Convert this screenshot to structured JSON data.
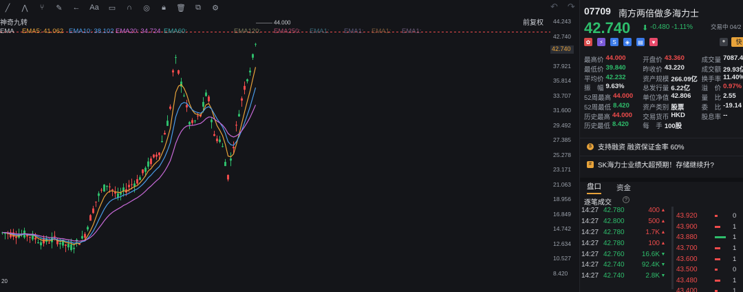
{
  "toolbar": {
    "tools": [
      "draw-line-icon",
      "polyline-icon",
      "fork-icon",
      "text-tool-icon",
      "arrow-icon",
      "font-size-icon",
      "rectangle-icon",
      "magnet-icon",
      "circle-icon",
      "lock-icon",
      "trash-icon",
      "copy-icon",
      "settings-icon"
    ],
    "font_glyph": "Aa"
  },
  "chart": {
    "strategy_label": "神奇九转",
    "restore_label": "前复权",
    "ema": [
      {
        "label": "EMA",
        "value": "",
        "color": "#c9ccd2"
      },
      {
        "label": "EMA5:",
        "value": "41.062",
        "color": "#e8a33a"
      },
      {
        "label": "EMA10:",
        "value": "38.102",
        "color": "#4a9be8"
      },
      {
        "label": "EMA20:",
        "value": "34.724",
        "color": "#c86ad8"
      },
      {
        "label": "EMA60:",
        "value": "",
        "color": "#3aa7a7"
      },
      {
        "label": "EMA120:",
        "value": "",
        "color": "#7a7a5a"
      },
      {
        "label": "EMA250:",
        "value": "",
        "color": "#a04a6a"
      },
      {
        "label": "EMA1:",
        "value": "",
        "color": "#3a6a7a"
      },
      {
        "label": "EMA1:",
        "value": "",
        "color": "#5a5a7a"
      },
      {
        "label": "EMA1:",
        "value": "",
        "color": "#7a5a3a"
      },
      {
        "label": "EMA1:",
        "value": "",
        "color": "#6a5a7a"
      }
    ],
    "price_ticks": [
      "44.243",
      "42.740",
      "40.029",
      "37.921",
      "35.814",
      "33.707",
      "31.600",
      "29.492",
      "27.385",
      "25.278",
      "23.171",
      "21.063",
      "18.956",
      "16.849",
      "14.742",
      "12.634",
      "10.527",
      "8.420"
    ],
    "high_label": "44.000",
    "low_label": "8.420",
    "last_price": "42.740",
    "colors": {
      "up": "#2ebd6b",
      "down": "#ef4b4b",
      "dashed": "#ef4b4b"
    }
  },
  "panel": {
    "code": "07709",
    "name": "南方两倍做多海力士",
    "price": "42.740",
    "arrow": "⬇",
    "change": "-0.480 -1.11%",
    "status": "交易中 04/2",
    "fast_label": "快",
    "stats": [
      [
        [
          "最高价",
          "44.000",
          "red"
        ],
        [
          "开盘价",
          "43.360",
          "red"
        ],
        [
          "成交量",
          "7087.4",
          "white"
        ]
      ],
      [
        [
          "最低价",
          "39.840",
          "green"
        ],
        [
          "昨收价",
          "43.220",
          "white"
        ],
        [
          "成交额",
          "29.93亿",
          "white"
        ]
      ],
      [
        [
          "平均价",
          "42.232",
          "green"
        ],
        [
          "资产规模",
          "266.09亿",
          "white"
        ],
        [
          "换手率",
          "11.40%",
          "white"
        ]
      ],
      [
        [
          "振　幅",
          "9.63%",
          "white"
        ],
        [
          "总发行量",
          "6.22亿",
          "white"
        ],
        [
          "溢　价",
          "0.97%",
          "red"
        ]
      ],
      [
        [
          "52周最高",
          "44.000",
          "red"
        ],
        [
          "单位净值",
          "42.806",
          "white"
        ],
        [
          "量　比",
          "2.55",
          "white"
        ]
      ],
      [
        [
          "52周最低",
          "8.420",
          "green"
        ],
        [
          "资产类别",
          "股票",
          "white"
        ],
        [
          "委　比",
          "-19.14",
          "white"
        ]
      ],
      [
        [
          "历史最高",
          "44.000",
          "red"
        ],
        [
          "交易货币",
          "HKD",
          "white"
        ],
        [
          "股息率",
          "--",
          "white"
        ]
      ],
      [
        [
          "历史最低",
          "8.420",
          "green"
        ],
        [
          "每　手",
          "100股",
          "white"
        ],
        [
          "",
          "",
          " white"
        ]
      ]
    ],
    "banner1": "支持融资  融资保证金率 60%",
    "banner2": "SK海力士业绩大超预期！存储继续升?",
    "tabs": [
      "盘口",
      "资金"
    ],
    "trades_title": "逐笔成交",
    "trades": [
      {
        "time": "14:27",
        "price": "42.780",
        "vol": "400",
        "dir": "up"
      },
      {
        "time": "14:27",
        "price": "42.800",
        "vol": "500",
        "dir": "up"
      },
      {
        "time": "14:27",
        "price": "42.780",
        "vol": "1.7K",
        "dir": "up"
      },
      {
        "time": "14:27",
        "price": "42.780",
        "vol": "100",
        "dir": "up"
      },
      {
        "time": "14:27",
        "price": "42.760",
        "vol": "16.6K",
        "dir": "down"
      },
      {
        "time": "14:27",
        "price": "42.740",
        "vol": "92.4K",
        "dir": "down"
      },
      {
        "time": "14:27",
        "price": "42.740",
        "vol": "2.8K",
        "dir": "down"
      }
    ],
    "book": [
      {
        "price": "43.920",
        "fill": 0.15,
        "val": "0"
      },
      {
        "price": "43.900",
        "fill": 0.3,
        "val": "1"
      },
      {
        "price": "43.880",
        "fill": 0.6,
        "val": "1"
      },
      {
        "price": "43.700",
        "fill": 0.3,
        "val": "1"
      },
      {
        "price": "43.600",
        "fill": 0.3,
        "val": "1"
      },
      {
        "price": "43.500",
        "fill": 0.15,
        "val": "0"
      },
      {
        "price": "43.480",
        "fill": 0.3,
        "val": "1"
      },
      {
        "price": "43.400",
        "fill": 0.15,
        "val": "1"
      }
    ]
  }
}
